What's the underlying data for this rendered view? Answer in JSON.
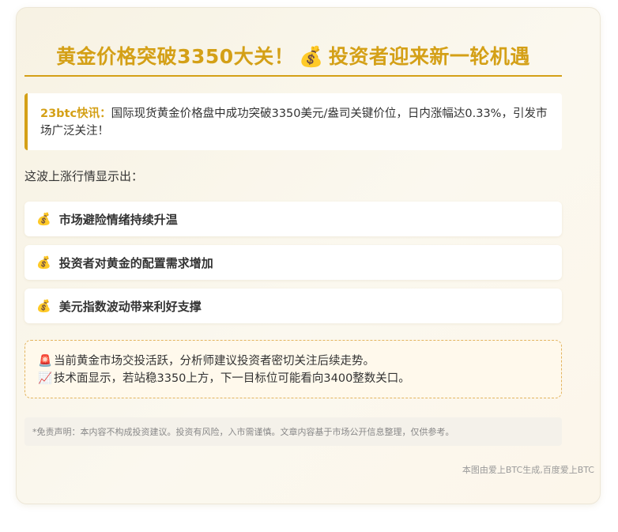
{
  "header": {
    "title_part1": "黄金价格突破3350大关！",
    "title_emoji": "💰",
    "title_part2": "投资者迎来新一轮机遇"
  },
  "flash": {
    "source_label": "23btc快讯：",
    "text": "国际现货黄金价格盘中成功突破3350美元/盎司关键价位，日内涨幅达0.33%，引发市场广泛关注！"
  },
  "intro": "这波上涨行情显示出：",
  "points": [
    {
      "emoji": "💰",
      "label": "市场避险情绪持续升温"
    },
    {
      "emoji": "💰",
      "label": "投资者对黄金的配置需求增加"
    },
    {
      "emoji": "💰",
      "label": "美元指数波动带来利好支撑"
    }
  ],
  "analysis": [
    {
      "emoji": "🚨",
      "text": "当前黄金市场交投活跃，分析师建议投资者密切关注后续走势。"
    },
    {
      "emoji": "📈",
      "text": "技术面显示，若站稳3350上方，下一目标位可能看向3400整数关口。"
    }
  ],
  "disclaimer": "*免责声明：本内容不构成投资建议。投资有风险，入市需谨慎。文章内容基于市场公开信息整理，仅供参考。",
  "footer": "本图由爱上BTC生成,百度爱上BTC",
  "colors": {
    "accent": "#d4a017",
    "card_background": "#f7f2e3",
    "analysis_border": "#e3b45e"
  }
}
